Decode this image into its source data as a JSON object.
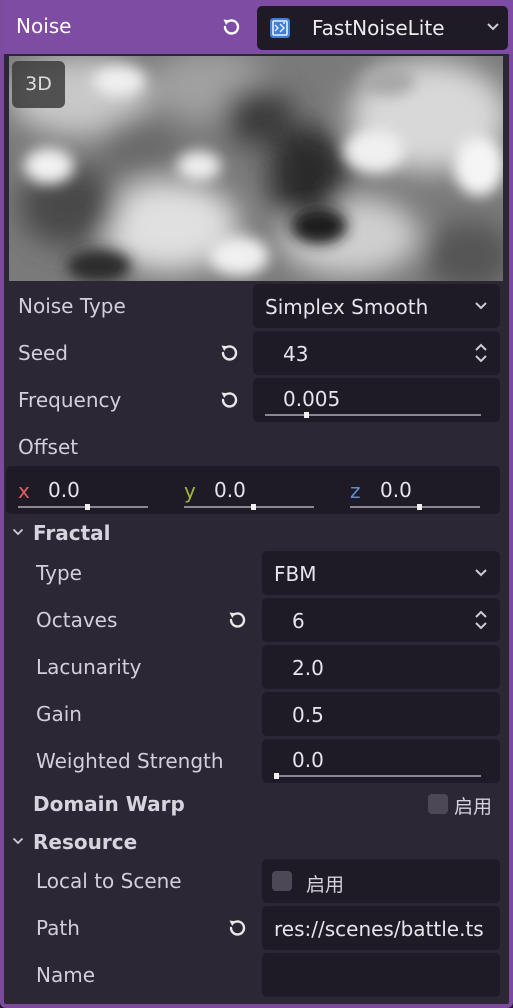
{
  "header": {
    "title": "Noise",
    "resource_type": "FastNoiseLite"
  },
  "preview": {
    "mode_button": "3D"
  },
  "props": {
    "noise_type": {
      "label": "Noise Type",
      "value": "Simplex Smooth"
    },
    "seed": {
      "label": "Seed",
      "value": "43"
    },
    "frequency": {
      "label": "Frequency",
      "value": "0.005",
      "slider_fraction": 0.18
    },
    "offset": {
      "label": "Offset",
      "x": {
        "axis": "x",
        "value": "0.0",
        "color": "#e0605e"
      },
      "y": {
        "axis": "y",
        "value": "0.0",
        "color": "#9fb73c"
      },
      "z": {
        "axis": "z",
        "value": "0.0",
        "color": "#5a8ed6"
      }
    }
  },
  "fractal": {
    "title": "Fractal",
    "type": {
      "label": "Type",
      "value": "FBM"
    },
    "octaves": {
      "label": "Octaves",
      "value": "6"
    },
    "lacunarity": {
      "label": "Lacunarity",
      "value": "2.0"
    },
    "gain": {
      "label": "Gain",
      "value": "0.5"
    },
    "weighted_strength": {
      "label": "Weighted Strength",
      "value": "0.0",
      "slider_fraction": 0.0
    }
  },
  "domain_warp": {
    "title": "Domain Warp",
    "enable_label": "启用",
    "enabled": false
  },
  "resource": {
    "title": "Resource",
    "local_to_scene": {
      "label": "Local to Scene",
      "check_label": "启用",
      "checked": false
    },
    "path": {
      "label": "Path",
      "value": "res://scenes/battle.ts"
    },
    "name": {
      "label": "Name",
      "value": ""
    }
  },
  "colors": {
    "header_accent": "#7e4ca2",
    "panel_bg": "#2c2734",
    "field_bg": "#1f1b26"
  }
}
